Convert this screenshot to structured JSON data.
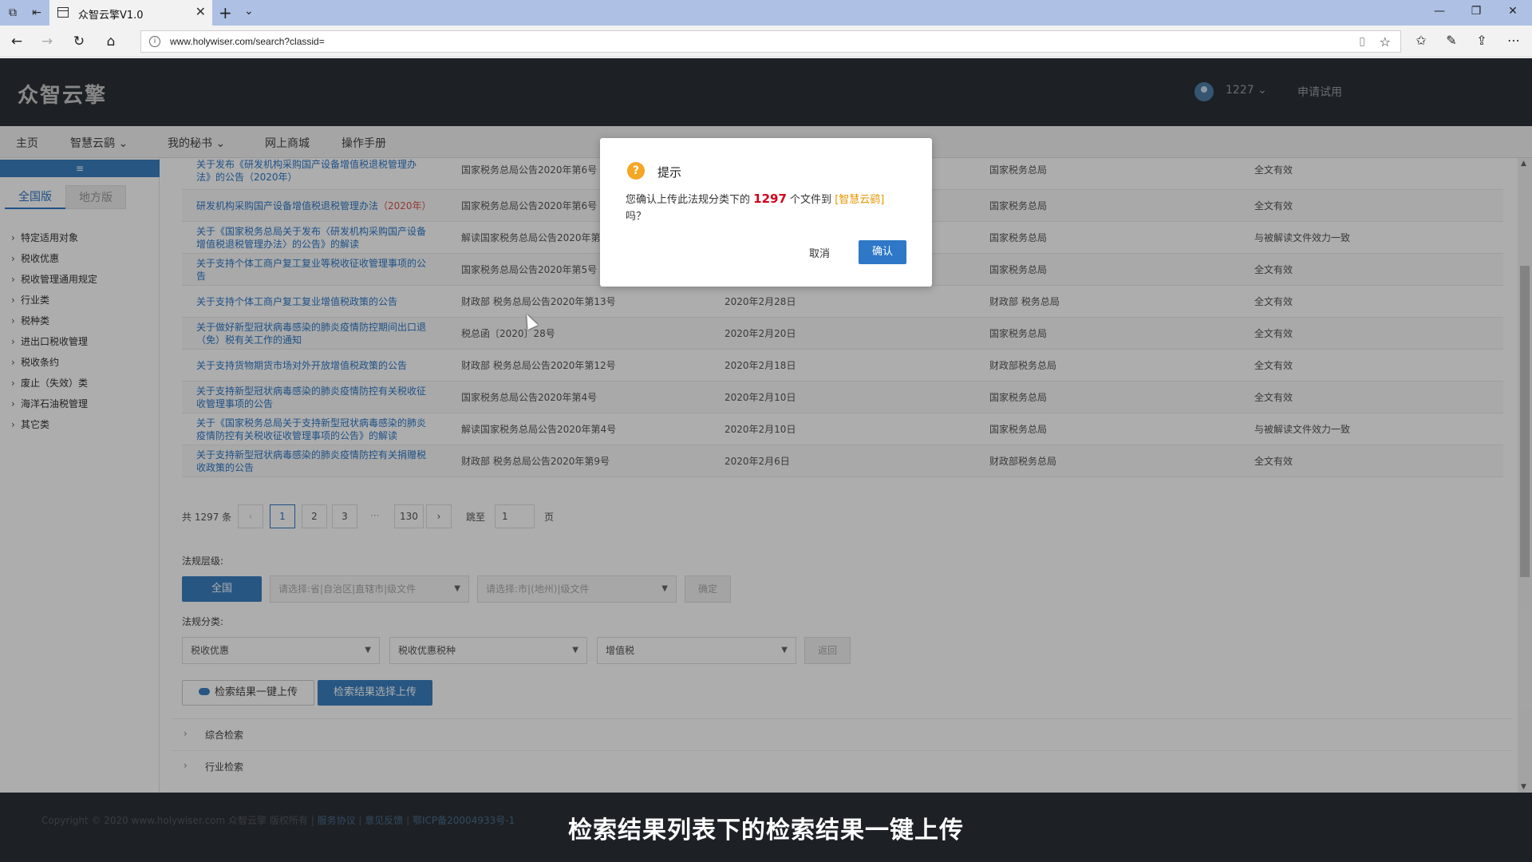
{
  "browser": {
    "tab_title": "众智云擎V1.0",
    "url": "www.holywiser.com/search?classid="
  },
  "header": {
    "logo": "众智云擎",
    "user": "1227",
    "trial": "申请试用"
  },
  "nav": [
    "主页",
    "智慧云鹞",
    "我的秘书",
    "网上商城",
    "操作手册"
  ],
  "sidebar": {
    "tabs": [
      "全国版",
      "地方版"
    ],
    "categories": [
      "特定适用对象",
      "税收优惠",
      "税收管理通用规定",
      "行业类",
      "税种类",
      "进出口税收管理",
      "税收条约",
      "废止（失效）类",
      "海洋石油税管理",
      "其它类"
    ]
  },
  "table": {
    "rows": [
      {
        "t1": "关于发布《研发机构采购国产设备增值税退税管理办",
        "t2": "法》的公告（2020年）",
        "doc": "国家税务总局公告2020年第6号",
        "date": "",
        "org": "国家税务总局",
        "status": "全文有效"
      },
      {
        "t1": "研发机构采购国产设备增值税退税管理办法",
        "t1_year": "（2020年）",
        "t2": "",
        "doc": "国家税务总局公告2020年第6号",
        "date": "",
        "org": "国家税务总局",
        "status": "全文有效"
      },
      {
        "t1": "关于《国家税务总局关于发布〈研发机构采购国产设备",
        "t2": "增值税退税管理办法〉的公告》的解读",
        "doc": "解读国家税务总局公告2020年第6号",
        "date": "",
        "org": "国家税务总局",
        "status": "与被解读文件效力一致"
      },
      {
        "t1": "关于支持个体工商户复工复业等税收征收管理事项的公",
        "t2": "告",
        "doc": "国家税务总局公告2020年第5号",
        "date": "",
        "org": "国家税务总局",
        "status": "全文有效"
      },
      {
        "t1": "关于支持个体工商户复工复业增值税政策的公告",
        "t2": "",
        "doc": "财政部 税务总局公告2020年第13号",
        "date": "2020年2月28日",
        "org": "财政部 税务总局",
        "status": "全文有效"
      },
      {
        "t1": "关于做好新型冠状病毒感染的肺炎疫情防控期间出口退",
        "t2": "（免）税有关工作的通知",
        "doc": "税总函〔2020〕28号",
        "date": "2020年2月20日",
        "org": "国家税务总局",
        "status": "全文有效"
      },
      {
        "t1": "关于支持货物期货市场对外开放增值税政策的公告",
        "t2": "",
        "doc": "财政部 税务总局公告2020年第12号",
        "date": "2020年2月18日",
        "org": "财政部税务总局",
        "status": "全文有效"
      },
      {
        "t1": "关于支持新型冠状病毒感染的肺炎疫情防控有关税收征",
        "t2": "收管理事项的公告",
        "doc": "国家税务总局公告2020年第4号",
        "date": "2020年2月10日",
        "org": "国家税务总局",
        "status": "全文有效"
      },
      {
        "t1": "关于《国家税务总局关于支持新型冠状病毒感染的肺炎",
        "t2": "疫情防控有关税收征收管理事项的公告》的解读",
        "doc": "解读国家税务总局公告2020年第4号",
        "date": "2020年2月10日",
        "org": "国家税务总局",
        "status": "与被解读文件效力一致"
      },
      {
        "t1": "关于支持新型冠状病毒感染的肺炎疫情防控有关捐赠税",
        "t2": "收政策的公告",
        "doc": "财政部 税务总局公告2020年第9号",
        "date": "2020年2月6日",
        "org": "财政部税务总局",
        "status": "全文有效"
      }
    ]
  },
  "pager": {
    "total": "共 1297 条",
    "prev": "‹",
    "pages": [
      "1",
      "2",
      "3"
    ],
    "dots": "···",
    "last": "130",
    "next": "›",
    "jump_label": "跳至",
    "jump_value": "1",
    "page_unit": "页"
  },
  "filters": {
    "level_label": "法规层级:",
    "all_btn": "全国",
    "level_sel1": "请选择:省|自治区|直辖市|级文件",
    "level_sel2": "请选择:市|(地州)|级文件",
    "confirm_btn": "确定",
    "class_label": "法规分类:",
    "class_sel1": "税收优惠",
    "class_sel2": "税收优惠税种",
    "class_sel3": "增值税",
    "back_btn": "返回",
    "upload_all": "检索结果一键上传",
    "upload_select": "检索结果选择上传"
  },
  "sections": [
    "综合检索",
    "行业检索"
  ],
  "footer": {
    "copyright": "Copyright © 2020 www.holywiser.com 众智云擎 版权所有",
    "link1": "服务协议",
    "link2": "意见反馈",
    "icp": "鄂ICP备20004933号-1",
    "sep": "|"
  },
  "dialog": {
    "title": "提示",
    "msg_prefix": "您确认上传此法规分类下的",
    "count": "1297",
    "msg_mid": "个文件到",
    "target": "[智慧云鹞]",
    "msg_suffix": "吗？",
    "cancel": "取消",
    "ok": "确认"
  },
  "caption": "检索结果列表下的检索结果一键上传",
  "colors": {
    "accent": "#2e78c7",
    "header_bg": "#2b3036",
    "warning": "#f5a623",
    "count": "#d0021b"
  }
}
